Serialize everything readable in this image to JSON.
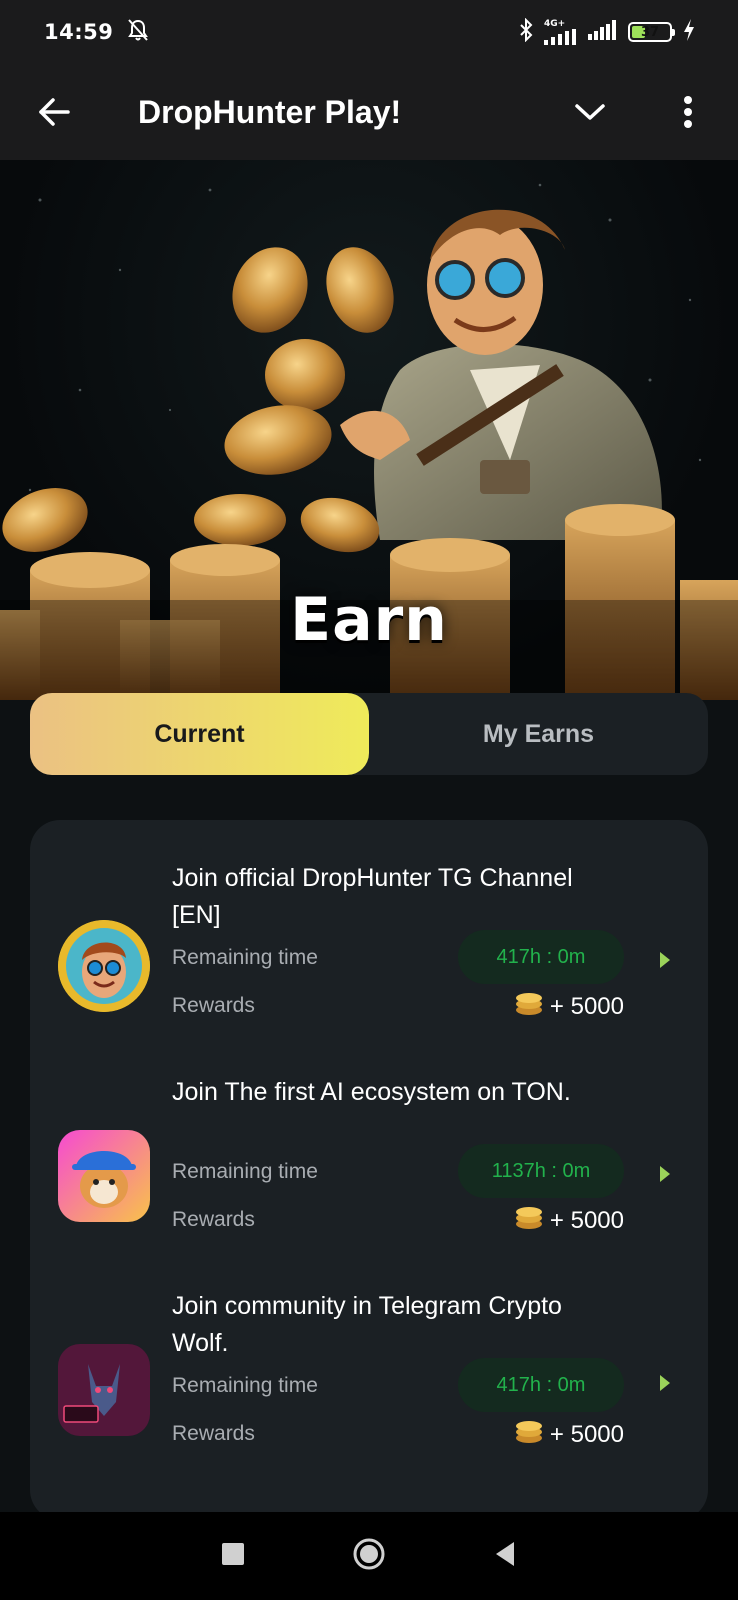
{
  "status_bar": {
    "time": "14:59",
    "network_label": "4G+",
    "battery_level": "37",
    "icons": [
      "mute-bell-icon",
      "bluetooth-icon",
      "signal-icon",
      "signal-icon",
      "battery-icon",
      "charging-icon"
    ]
  },
  "app_bar": {
    "title": "DropHunter Play!",
    "icons": [
      "back-arrow-icon",
      "chevron-down-icon",
      "more-vert-icon"
    ]
  },
  "hero": {
    "title": "Earn"
  },
  "tabs": [
    {
      "label": "Current",
      "active": true
    },
    {
      "label": "My Earns",
      "active": false
    }
  ],
  "tasks": [
    {
      "title": "Join official DropHunter TG Channel [EN]",
      "remaining_label": "Remaining time",
      "remaining_value": "417h : 0m",
      "rewards_label": "Rewards",
      "reward_value": "+ 5000"
    },
    {
      "title": "Join The first AI ecosystem on TON.",
      "remaining_label": "Remaining time",
      "remaining_value": "1137h : 0m",
      "rewards_label": "Rewards",
      "reward_value": "+ 5000"
    },
    {
      "title": "Join community in Telegram Crypto Wolf.",
      "remaining_label": "Remaining time",
      "remaining_value": "417h : 0m",
      "rewards_label": "Rewards",
      "reward_value": "+ 5000"
    }
  ],
  "nav_bar": {
    "icons": [
      "recents-square-icon",
      "home-circle-icon",
      "back-triangle-icon"
    ]
  },
  "colors": {
    "background": "#0d1113",
    "card": "#1b2024",
    "tab_gradient_start": "#ebc183",
    "tab_gradient_end": "#efeb5a",
    "pill_bg": "#142a1f",
    "pill_text": "#22b24c",
    "arrow": "#9bd35a"
  }
}
